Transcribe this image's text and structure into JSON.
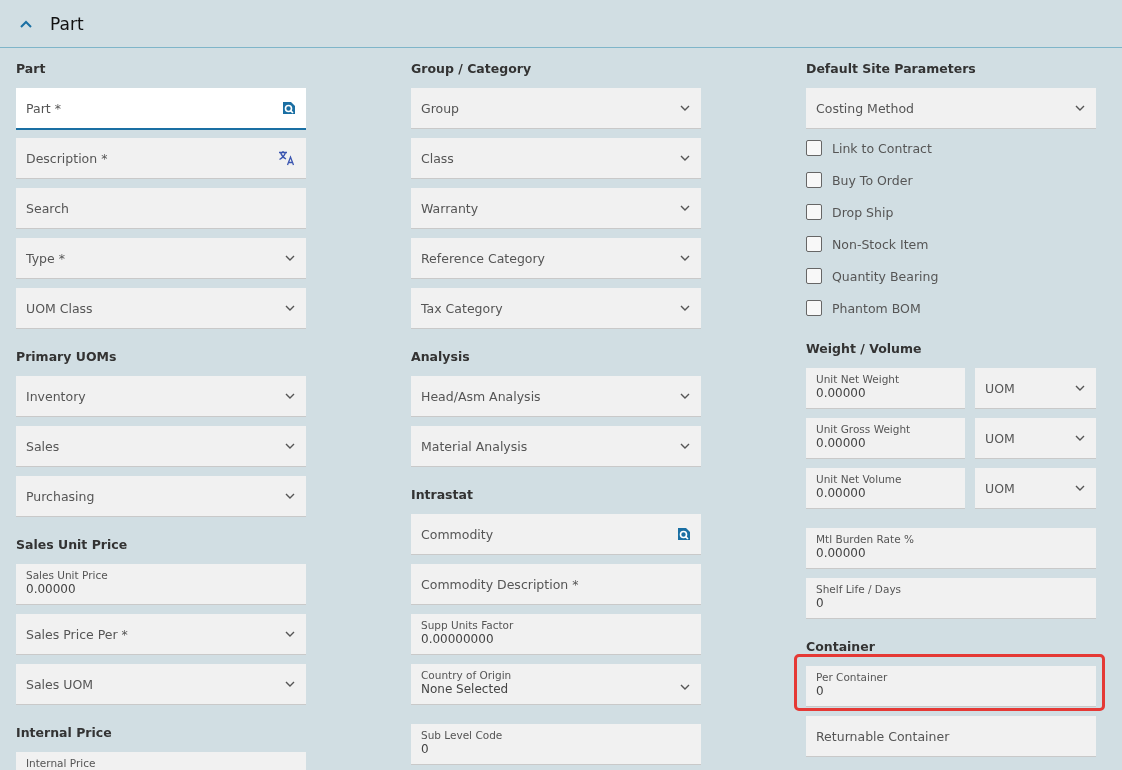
{
  "section": {
    "title": "Part",
    "expanded": true
  },
  "columns": [
    [
      {
        "heading": "Part",
        "fields": [
          {
            "kind": "lookup",
            "placeholder": "Part *",
            "focused": true
          },
          {
            "kind": "translate",
            "placeholder": "Description *"
          },
          {
            "kind": "text",
            "placeholder": "Search"
          },
          {
            "kind": "select",
            "placeholder": "Type *"
          },
          {
            "kind": "select",
            "placeholder": "UOM Class"
          }
        ]
      },
      {
        "heading": "Primary UOMs",
        "fields": [
          {
            "kind": "select",
            "placeholder": "Inventory"
          },
          {
            "kind": "select",
            "placeholder": "Sales"
          },
          {
            "kind": "select",
            "placeholder": "Purchasing"
          }
        ]
      },
      {
        "heading": "Sales Unit Price",
        "fields": [
          {
            "kind": "value",
            "label": "Sales Unit Price",
            "value": "0.00000"
          },
          {
            "kind": "select",
            "placeholder": "Sales Price Per *"
          },
          {
            "kind": "select",
            "placeholder": "Sales UOM"
          }
        ]
      },
      {
        "heading": "Internal Price",
        "fields": [
          {
            "kind": "value",
            "label": "Internal Price"
          }
        ]
      }
    ],
    [
      {
        "heading": "Group / Category",
        "fields": [
          {
            "kind": "select",
            "placeholder": "Group"
          },
          {
            "kind": "select",
            "placeholder": "Class"
          },
          {
            "kind": "select",
            "placeholder": "Warranty"
          },
          {
            "kind": "select",
            "placeholder": "Reference Category"
          },
          {
            "kind": "select",
            "placeholder": "Tax Category"
          }
        ]
      },
      {
        "heading": "Analysis",
        "fields": [
          {
            "kind": "select",
            "placeholder": "Head/Asm Analysis"
          },
          {
            "kind": "select",
            "placeholder": "Material Analysis"
          }
        ]
      },
      {
        "heading": "Intrastat",
        "fields": [
          {
            "kind": "lookup",
            "placeholder": "Commodity",
            "focused": false
          },
          {
            "kind": "text",
            "placeholder": "Commodity Description *"
          },
          {
            "kind": "value",
            "label": "Supp Units Factor",
            "value": "0.00000000"
          },
          {
            "kind": "value_select",
            "label": "Country of Origin",
            "value": "None Selected"
          }
        ]
      },
      {
        "fields": [
          {
            "kind": "value",
            "label": "Sub Level Code",
            "value": "0"
          }
        ]
      }
    ],
    [
      {
        "heading": "Default Site Parameters",
        "fields": [
          {
            "kind": "select",
            "placeholder": "Costing Method"
          },
          {
            "kind": "checkbox",
            "label": "Link to Contract",
            "checked": false
          },
          {
            "kind": "checkbox",
            "label": "Buy To Order",
            "checked": false
          },
          {
            "kind": "checkbox",
            "label": "Drop Ship",
            "checked": false
          },
          {
            "kind": "checkbox",
            "label": "Non-Stock Item",
            "checked": false
          },
          {
            "kind": "checkbox",
            "label": "Quantity Bearing",
            "checked": false
          },
          {
            "kind": "checkbox",
            "label": "Phantom BOM",
            "checked": false
          }
        ]
      },
      {
        "heading": "Weight / Volume",
        "fields": [
          {
            "kind": "pair",
            "label": "Unit Net Weight",
            "value": "0.00000",
            "unit": "UOM"
          },
          {
            "kind": "pair",
            "label": "Unit Gross Weight",
            "value": "0.00000",
            "unit": "UOM"
          },
          {
            "kind": "pair",
            "label": "Unit Net Volume",
            "value": "0.00000",
            "unit": "UOM"
          }
        ]
      },
      {
        "fields": [
          {
            "kind": "value",
            "label": "Mtl Burden Rate %",
            "value": "0.00000"
          },
          {
            "kind": "value",
            "label": "Shelf Life / Days",
            "value": "0"
          }
        ]
      },
      {
        "heading": "Container",
        "fields": [
          {
            "kind": "value",
            "label": "Per Container",
            "value": "0",
            "highlighted": true
          },
          {
            "kind": "text",
            "placeholder": "Returnable Container"
          }
        ]
      }
    ]
  ]
}
